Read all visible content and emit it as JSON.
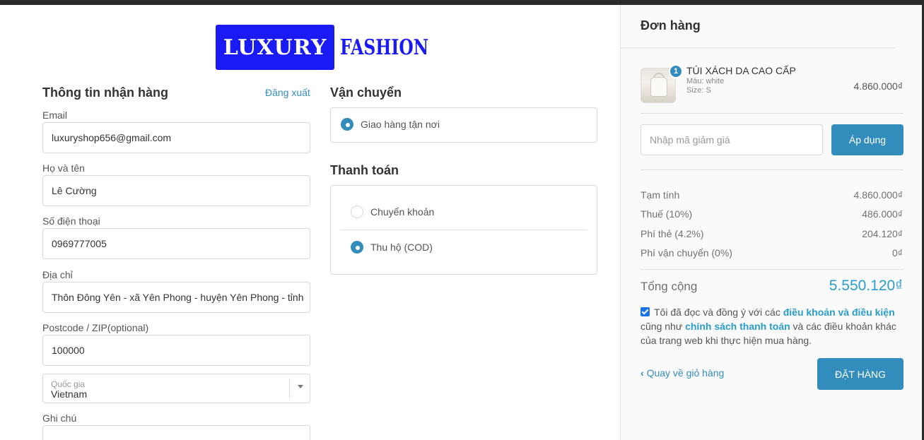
{
  "brand": {
    "part1": "LUXURY",
    "part2": "FASHION"
  },
  "delivery_info": {
    "title": "Thông tin nhận hàng",
    "logout": "Đăng xuất",
    "email": {
      "label": "Email",
      "value": "luxuryshop656@gmail.com"
    },
    "name": {
      "label": "Họ và tên",
      "value": "Lê Cường"
    },
    "phone": {
      "label": "Số điện thoại",
      "value": "0969777005"
    },
    "address": {
      "label": "Địa chỉ",
      "value": "Thôn Đông Yên - xã Yên Phong - huyện Yên Phong - tỉnh"
    },
    "postcode": {
      "label": "Postcode / ZIP(optional)",
      "value": "100000"
    },
    "country": {
      "label": "Quốc gia",
      "value": "Vietnam"
    },
    "note": {
      "label": "Ghi chú",
      "value": ""
    }
  },
  "shipping": {
    "title": "Vận chuyển",
    "option": "Giao hàng tận nơi"
  },
  "payment": {
    "title": "Thanh toán",
    "options": [
      {
        "label": "Chuyển khoản",
        "selected": false
      },
      {
        "label": "Thu hộ (COD)",
        "selected": true
      }
    ]
  },
  "order": {
    "title": "Đơn hàng",
    "item": {
      "qty": "1",
      "name": "TÚI XÁCH DA CAO CẤP",
      "color": "Màu: white",
      "size": "Size: S",
      "price": "4.860.000₫"
    },
    "discount_placeholder": "Nhập mã giảm giá",
    "apply_label": "Áp dụng",
    "rows": [
      {
        "label": "Tạm tính",
        "value": "4.860.000₫"
      },
      {
        "label": "Thuế (10%)",
        "value": "486.000₫"
      },
      {
        "label": "Phí thẻ (4.2%)",
        "value": "204.120₫"
      },
      {
        "label": "Phí vận chuyển (0%)",
        "value": "0₫"
      }
    ],
    "total_label": "Tổng cộng",
    "total_value": "5.550.120₫",
    "agree": {
      "t1": "Tôi đã đọc và đồng ý với các ",
      "link1": "điều khoản và điều kiện",
      "t2": " cũng như ",
      "link2": "chính sách thanh toán",
      "t3": " và các điều khoản khác của trang web khi thực hiện mua hàng."
    },
    "back_label": "Quay về giỏ hàng",
    "submit_label": "ĐẶT HÀNG"
  },
  "colors": {
    "accent": "#338dbc",
    "brand": "#1a1af5",
    "total": "#2a9dcc"
  }
}
